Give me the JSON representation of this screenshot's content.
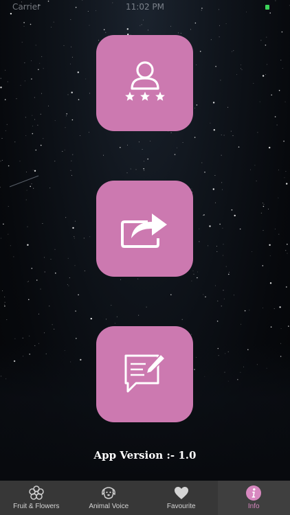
{
  "status_bar": {
    "carrier": "Carrier",
    "time": "11:02 PM",
    "battery_color": "#3cd35a"
  },
  "actions": [
    {
      "name": "rate-app",
      "icon": "user-rating-icon"
    },
    {
      "name": "share-app",
      "icon": "share-icon"
    },
    {
      "name": "feedback",
      "icon": "feedback-icon"
    }
  ],
  "app_version": {
    "text": "App Version :-  1.0"
  },
  "tab_bar": {
    "selected": "Info",
    "tabs": [
      {
        "label": "Fruit & Flowers",
        "icon": "flower-icon"
      },
      {
        "label": "Animal Voice",
        "icon": "dog-icon"
      },
      {
        "label": "Favourite",
        "icon": "heart-icon"
      },
      {
        "label": "Info",
        "icon": "info-icon"
      }
    ]
  },
  "colors": {
    "tile": "#cc79b0",
    "tab_bar": "#373737",
    "active_tab": "#d888c0",
    "inactive_tab": "#d6d6d6",
    "background": "#0c1016"
  }
}
